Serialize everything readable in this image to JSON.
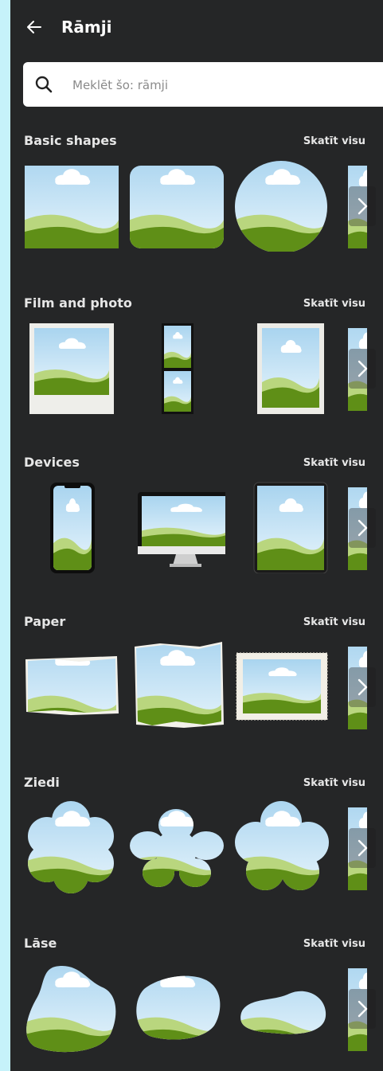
{
  "header": {
    "title": "Rāmji",
    "back_icon": "arrow-left-icon"
  },
  "search": {
    "placeholder": "Meklēt šo: rāmji",
    "value": "",
    "icon": "search-icon"
  },
  "sections": [
    {
      "title": "Basic shapes",
      "see_all": "Skatīt visu",
      "items": [
        "square-frame",
        "rounded-square-frame",
        "circle-frame"
      ]
    },
    {
      "title": "Film and photo",
      "see_all": "Skatīt visu",
      "items": [
        "polaroid-frame",
        "photo-strip-frame",
        "film-print-frame"
      ]
    },
    {
      "title": "Devices",
      "see_all": "Skatīt visu",
      "items": [
        "phone-frame",
        "monitor-frame",
        "tablet-frame"
      ]
    },
    {
      "title": "Paper",
      "see_all": "Skatīt visu",
      "items": [
        "torn-paper-landscape-frame",
        "torn-paper-frame",
        "deckled-paper-frame"
      ]
    },
    {
      "title": "Ziedi",
      "see_all": "Skatīt visu",
      "items": [
        "flower-frame-1",
        "flower-frame-2",
        "flower-frame-3"
      ]
    },
    {
      "title": "Lāse",
      "see_all": "Skatīt visu",
      "items": [
        "blob-frame-1",
        "blob-frame-2",
        "blob-frame-3"
      ]
    }
  ],
  "colors": {
    "panel_bg": "#252627",
    "sky_top": "#a9d4ef",
    "sky_bottom": "#e8f5fc",
    "grass_dark": "#5f8f17",
    "grass_light": "#b9d67e",
    "page_border": "#c6f2fa"
  },
  "next_icon": "chevron-right-icon"
}
